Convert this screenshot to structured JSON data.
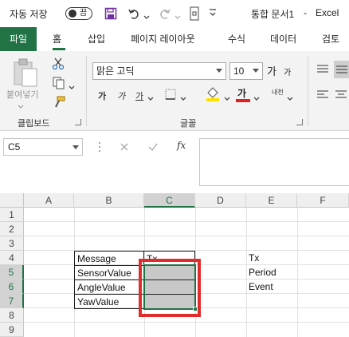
{
  "titlebar": {
    "autosave_label": "자동 저장",
    "toggle_state": "끔",
    "title": "통합 문서1",
    "app": "Excel",
    "separator": "-"
  },
  "tabs": [
    {
      "label": "파일",
      "name": "tab-file"
    },
    {
      "label": "홈",
      "name": "tab-home"
    },
    {
      "label": "삽입",
      "name": "tab-insert"
    },
    {
      "label": "페이지 레이아웃",
      "name": "tab-page-layout"
    },
    {
      "label": "수식",
      "name": "tab-formulas"
    },
    {
      "label": "데이터",
      "name": "tab-data"
    },
    {
      "label": "검토",
      "name": "tab-review"
    }
  ],
  "ribbon": {
    "clipboard_label": "클립보드",
    "paste_label": "붙여넣기",
    "font_group_label": "글꼴",
    "font_name": "맑은 고딕",
    "font_size": "10",
    "bold": "가",
    "italic": "가",
    "underline": "가",
    "grow": "가",
    "shrink": "가",
    "font_color": "가",
    "phonetic": "내천",
    "accent_font_color": "#e02020",
    "accent_highlight": "#ffe100"
  },
  "formula": {
    "name_box": "C5",
    "fx": "fx",
    "content": ""
  },
  "grid": {
    "columns": [
      "A",
      "B",
      "C",
      "D",
      "E",
      "F"
    ],
    "selected_column": "C",
    "rows": [
      "1",
      "2",
      "3",
      "4",
      "5",
      "6",
      "7",
      "8",
      "9"
    ],
    "cells": {
      "B4": "Message",
      "B5": "SensorValue",
      "B6": "AngleValue",
      "B7": "YawValue",
      "C4": "Tx",
      "E4": "Tx",
      "E5": "Period",
      "E6": "Event"
    },
    "highlight_color": "#e12c2c",
    "accent_color": "#217346"
  }
}
